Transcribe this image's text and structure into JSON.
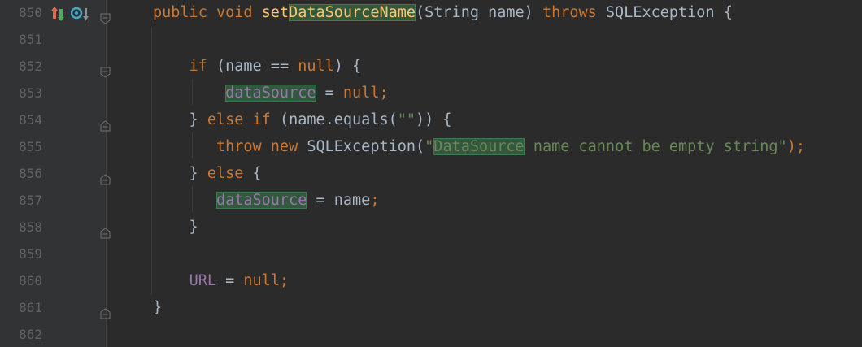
{
  "editor": {
    "lines": [
      {
        "number": "850",
        "tokens": [
          {
            "t": "public void ",
            "c": "kw"
          },
          {
            "t": "set",
            "c": "fn"
          },
          {
            "t": "DataSourceName",
            "c": "fn hl"
          },
          {
            "t": "(String name) ",
            "c": ""
          },
          {
            "t": "throws ",
            "c": "kw"
          },
          {
            "t": "SQLException {",
            "c": ""
          }
        ]
      },
      {
        "number": "851",
        "tokens": []
      },
      {
        "number": "852",
        "tokens": [
          {
            "t": "    ",
            "c": ""
          },
          {
            "t": "if ",
            "c": "kw"
          },
          {
            "t": "(name == ",
            "c": ""
          },
          {
            "t": "null",
            "c": "kw"
          },
          {
            "t": ") {",
            "c": ""
          }
        ]
      },
      {
        "number": "853",
        "tokens": [
          {
            "t": "        ",
            "c": ""
          },
          {
            "t": "dataSource",
            "c": "fld hl"
          },
          {
            "t": " = ",
            "c": ""
          },
          {
            "t": "null;",
            "c": "kw"
          }
        ]
      },
      {
        "number": "854",
        "tokens": [
          {
            "t": "    } ",
            "c": ""
          },
          {
            "t": "else if ",
            "c": "kw"
          },
          {
            "t": "(name.equals(",
            "c": ""
          },
          {
            "t": "\"\"",
            "c": "str"
          },
          {
            "t": ")) {",
            "c": ""
          }
        ]
      },
      {
        "number": "855",
        "tokens": [
          {
            "t": "       ",
            "c": ""
          },
          {
            "t": "throw new ",
            "c": "kw"
          },
          {
            "t": "SQLException(",
            "c": ""
          },
          {
            "t": "\"",
            "c": "str"
          },
          {
            "t": "DataSource",
            "c": "str hl"
          },
          {
            "t": " name cannot be empty string\"",
            "c": "str"
          },
          {
            "t": ");",
            "c": "kw"
          }
        ]
      },
      {
        "number": "856",
        "tokens": [
          {
            "t": "    } ",
            "c": ""
          },
          {
            "t": "else ",
            "c": "kw"
          },
          {
            "t": "{",
            "c": ""
          }
        ]
      },
      {
        "number": "857",
        "tokens": [
          {
            "t": "       ",
            "c": ""
          },
          {
            "t": "dataSource",
            "c": "fld hl"
          },
          {
            "t": " = name",
            "c": ""
          },
          {
            "t": ";",
            "c": "kw"
          }
        ]
      },
      {
        "number": "858",
        "tokens": [
          {
            "t": "    }",
            "c": ""
          }
        ]
      },
      {
        "number": "859",
        "tokens": []
      },
      {
        "number": "860",
        "tokens": [
          {
            "t": "    ",
            "c": ""
          },
          {
            "t": "URL",
            "c": "fld"
          },
          {
            "t": " = ",
            "c": ""
          },
          {
            "t": "null;",
            "c": "kw"
          }
        ]
      },
      {
        "number": "861",
        "tokens": [
          {
            "t": "}",
            "c": ""
          }
        ]
      },
      {
        "number": "862",
        "tokens": []
      }
    ]
  },
  "gutter_icons": [
    "override-method-icon",
    "implemented-method-icon"
  ],
  "colors": {
    "background": "#2b2b2b",
    "keyword": "#cc7832",
    "method": "#ffc66d",
    "string": "#6a8759",
    "field": "#9876aa",
    "text": "#a9b7c6",
    "line_number": "#606366",
    "highlight": "#32593d"
  }
}
